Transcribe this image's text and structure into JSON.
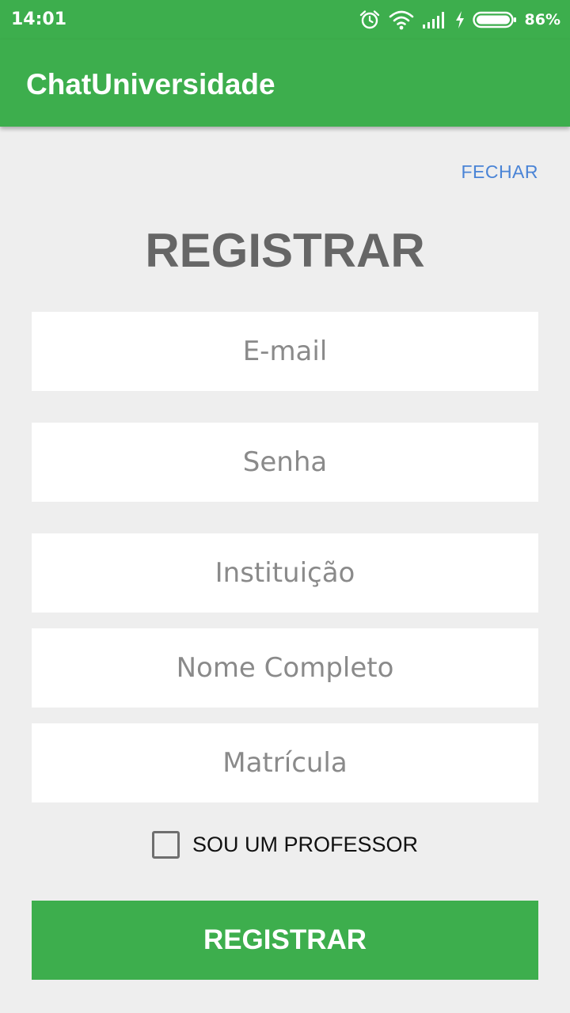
{
  "status_bar": {
    "time": "14:01",
    "battery_percent": "86%",
    "icons": [
      "alarm-icon",
      "wifi-icon",
      "signal-icon",
      "charging-icon",
      "battery-icon"
    ]
  },
  "app_bar": {
    "title": "ChatUniversidade",
    "color": "#3dae4d"
  },
  "header": {
    "close_label": "FECHAR",
    "title": "REGISTRAR"
  },
  "form": {
    "email_placeholder": "E-mail",
    "password_placeholder": "Senha",
    "institution_placeholder": "Instituição",
    "full_name_placeholder": "Nome Completo",
    "registration_placeholder": "Matrícula",
    "professor_checkbox_label": "SOU UM PROFESSOR",
    "professor_checked": false,
    "submit_label": "REGISTRAR"
  },
  "colors": {
    "accent": "#3dae4d",
    "link": "#4a84d6",
    "background": "#eeeeee"
  }
}
